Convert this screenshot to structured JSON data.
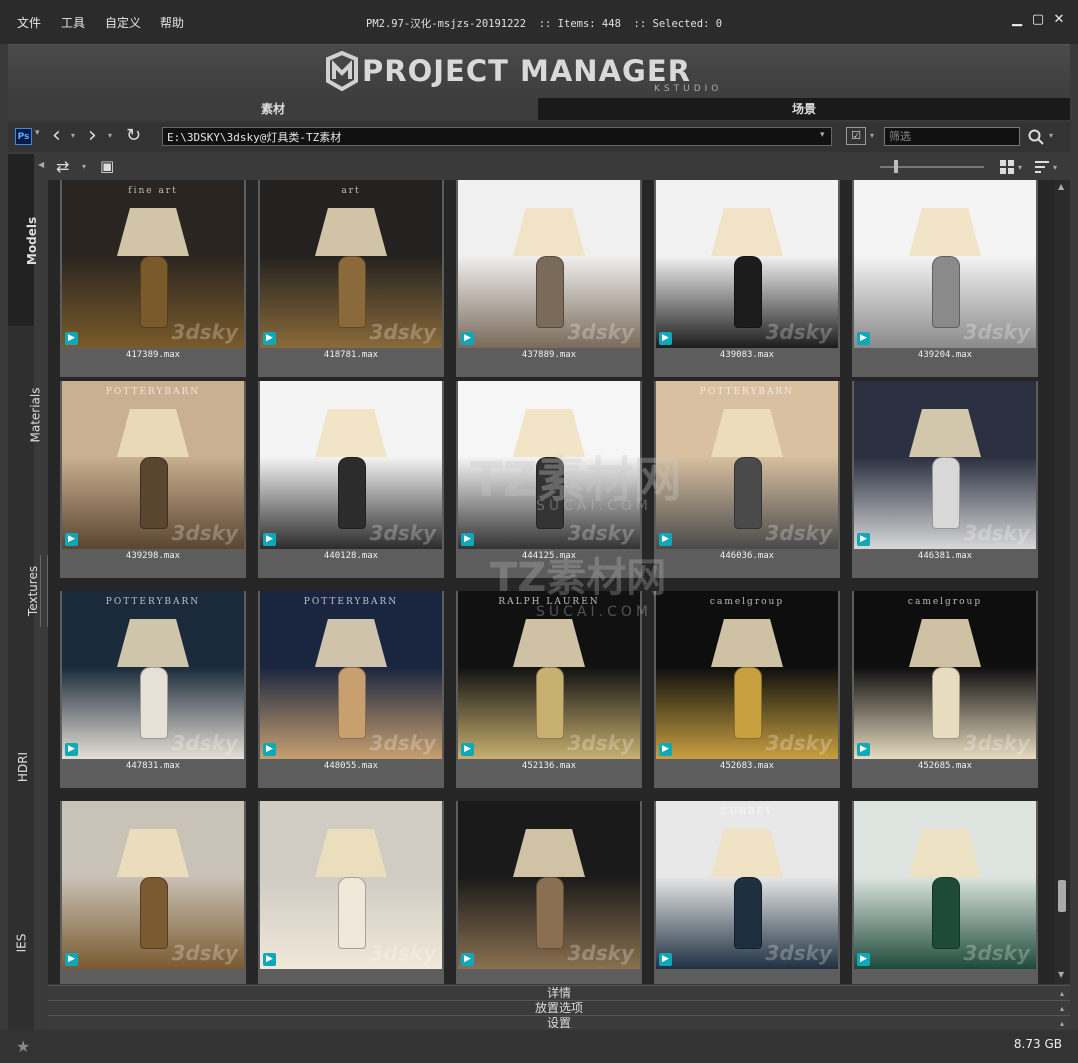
{
  "menu": [
    "文件",
    "工具",
    "自定义",
    "帮助"
  ],
  "title_info": "PM2.97-汉化-msjzs-20191222  :: Items: 448  :: Selected: 0",
  "window_controls": {
    "minimize": "▁",
    "maximize": "▢",
    "close": "✕"
  },
  "logo": {
    "title": "PROJECT MANAGER",
    "subtitle": "KSTUDIO"
  },
  "main_tabs": [
    "素材",
    "场景"
  ],
  "path_bar": {
    "ps_label": "Ps",
    "path": "E:\\3DSKY\\3dsky@灯具类-TZ素材",
    "filter_placeholder": "筛选"
  },
  "side_tabs": [
    "Models",
    "Materials",
    "Textures",
    "HDRI",
    "IES"
  ],
  "watermark": {
    "main": "TZ素材网",
    "sub": "SUCAI.COM"
  },
  "tiles": [
    {
      "label": "417389.max",
      "colors": [
        "#2a2521",
        "#7a5a2a"
      ],
      "wm": "3dsky",
      "brand": "fine art"
    },
    {
      "label": "418781.max",
      "colors": [
        "#232220",
        "#8a6a3a"
      ],
      "wm": "3dsky",
      "brand": "art"
    },
    {
      "label": "437889.max",
      "colors": [
        "#f0f0f0",
        "#7a6a5a"
      ],
      "wm": "3dsky",
      "brand": ""
    },
    {
      "label": "439083.max",
      "colors": [
        "#f2f2f2",
        "#1c1c1c"
      ],
      "wm": "3dsky",
      "brand": ""
    },
    {
      "label": "439204.max",
      "colors": [
        "#f4f4f4",
        "#8a8a8a"
      ],
      "wm": "3dsky",
      "brand": ""
    },
    {
      "label": "439298.max",
      "colors": [
        "#c8b090",
        "#5a4530"
      ],
      "wm": "3dsky",
      "brand": "POTTERYBARN"
    },
    {
      "label": "440128.max",
      "colors": [
        "#f4f4f4",
        "#2c2c2c"
      ],
      "wm": "3dsky",
      "brand": ""
    },
    {
      "label": "444125.max",
      "colors": [
        "#f6f6f6",
        "#333333"
      ],
      "wm": "3dsky",
      "brand": ""
    },
    {
      "label": "446036.max",
      "colors": [
        "#d8c0a0",
        "#4a4a4a"
      ],
      "wm": "3dsky",
      "brand": "POTTERYBARN"
    },
    {
      "label": "446381.max",
      "colors": [
        "#2a3040",
        "#d8d8d8"
      ],
      "wm": "3dsky",
      "brand": ""
    },
    {
      "label": "447831.max",
      "colors": [
        "#1a2a3a",
        "#e6e0d6"
      ],
      "wm": "3dsky",
      "brand": "POTTERYBARN"
    },
    {
      "label": "448055.max",
      "colors": [
        "#1a2540",
        "#c8a070"
      ],
      "wm": "3dsky",
      "brand": "POTTERYBARN"
    },
    {
      "label": "452136.max",
      "colors": [
        "#111111",
        "#c8b070"
      ],
      "wm": "3dsky",
      "brand": "RALPH LAUREN"
    },
    {
      "label": "452683.max",
      "colors": [
        "#0e0e0e",
        "#c8a040"
      ],
      "wm": "3dsky",
      "brand": "camelgroup"
    },
    {
      "label": "452685.max",
      "colors": [
        "#0e0e0e",
        "#e8dcc0"
      ],
      "wm": "3dsky",
      "brand": "camelgroup"
    },
    {
      "label": "",
      "colors": [
        "#c9c2b6",
        "#7a5a30"
      ],
      "wm": "3dsky",
      "brand": ""
    },
    {
      "label": "",
      "colors": [
        "#d0ccc4",
        "#f0e8d8"
      ],
      "wm": "3dsky",
      "brand": ""
    },
    {
      "label": "",
      "colors": [
        "#1a1a1a",
        "#8a7050"
      ],
      "wm": "3dsky",
      "brand": ""
    },
    {
      "label": "",
      "colors": [
        "#e8e8e8",
        "#1e3040"
      ],
      "wm": "3dsky",
      "brand": "CURREY"
    },
    {
      "label": "",
      "colors": [
        "#dde4e0",
        "#1e4a3a"
      ],
      "wm": "3dsky",
      "brand": ""
    }
  ],
  "bottom_panels": [
    "详情",
    "放置选项",
    "设置"
  ],
  "status": {
    "storage": "8.73 GB",
    "star": "★"
  }
}
